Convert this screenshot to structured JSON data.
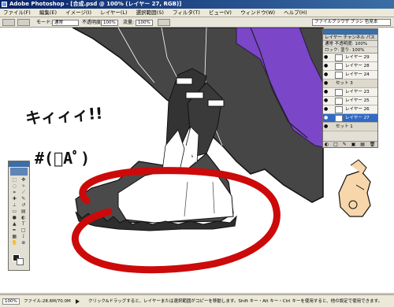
{
  "window": {
    "title": "Adobe Photoshop - [合成.psd @ 100% (レイヤー 27, RGB)]"
  },
  "menubar": {
    "items": [
      "ファイル(F)",
      "編集(E)",
      "イメージ(I)",
      "レイヤー(L)",
      "選択範囲(S)",
      "フィルタ(T)",
      "ビュー(V)",
      "ウィンドウ(W)",
      "ヘルプ(H)"
    ]
  },
  "options": {
    "mode_label": "モード:",
    "mode_value": "通常",
    "opacity_label": "不透明度:",
    "opacity_value": "100%",
    "flow_label": "流量:",
    "flow_value": "100%",
    "tabs_label": "ファイルブラウザ ブラシ 色見本"
  },
  "canvas": {
    "sfx_text": "キィィィ!!",
    "face_text": "#(ﾟAﾟ)"
  },
  "layers": {
    "tabs": "レイヤー チャンネル パス",
    "blend_mode": "通常",
    "opacity": "不透明度: 100%",
    "lock": "ロック:",
    "fill": "塗り: 100%",
    "rows": [
      {
        "name": "レイヤー 29",
        "kind": "layer",
        "selected": false
      },
      {
        "name": "レイヤー 28",
        "kind": "layer",
        "selected": false
      },
      {
        "name": "レイヤー 24",
        "kind": "layer",
        "selected": false
      },
      {
        "name": "セット 3",
        "kind": "set",
        "selected": false
      },
      {
        "name": "レイヤー 23",
        "kind": "layer",
        "selected": false
      },
      {
        "name": "レイヤー 25",
        "kind": "layer",
        "selected": false
      },
      {
        "name": "レイヤー 26",
        "kind": "layer",
        "selected": false
      },
      {
        "name": "レイヤー 27",
        "kind": "layer",
        "selected": true
      },
      {
        "name": "セット 1",
        "kind": "set",
        "selected": false
      }
    ],
    "footer": "◐ □ ✎ ▣ ▤ 🗑"
  },
  "status": {
    "zoom": "100%",
    "doc": "ファイル:28.6M/70.0M",
    "hint": "クリック&ドラッグすると、レイヤーまたは選択範囲がコピーを移動します。Shift キー・Alt キー・Ctrl キーを使用すると、他の設定で使用できます。"
  },
  "colors": {
    "title_bar": "#0a246a",
    "coat": "#464646",
    "purple_cloth": "#7b46c8",
    "skin": "#f6d6aa",
    "red_circle": "#cc0a0a"
  }
}
